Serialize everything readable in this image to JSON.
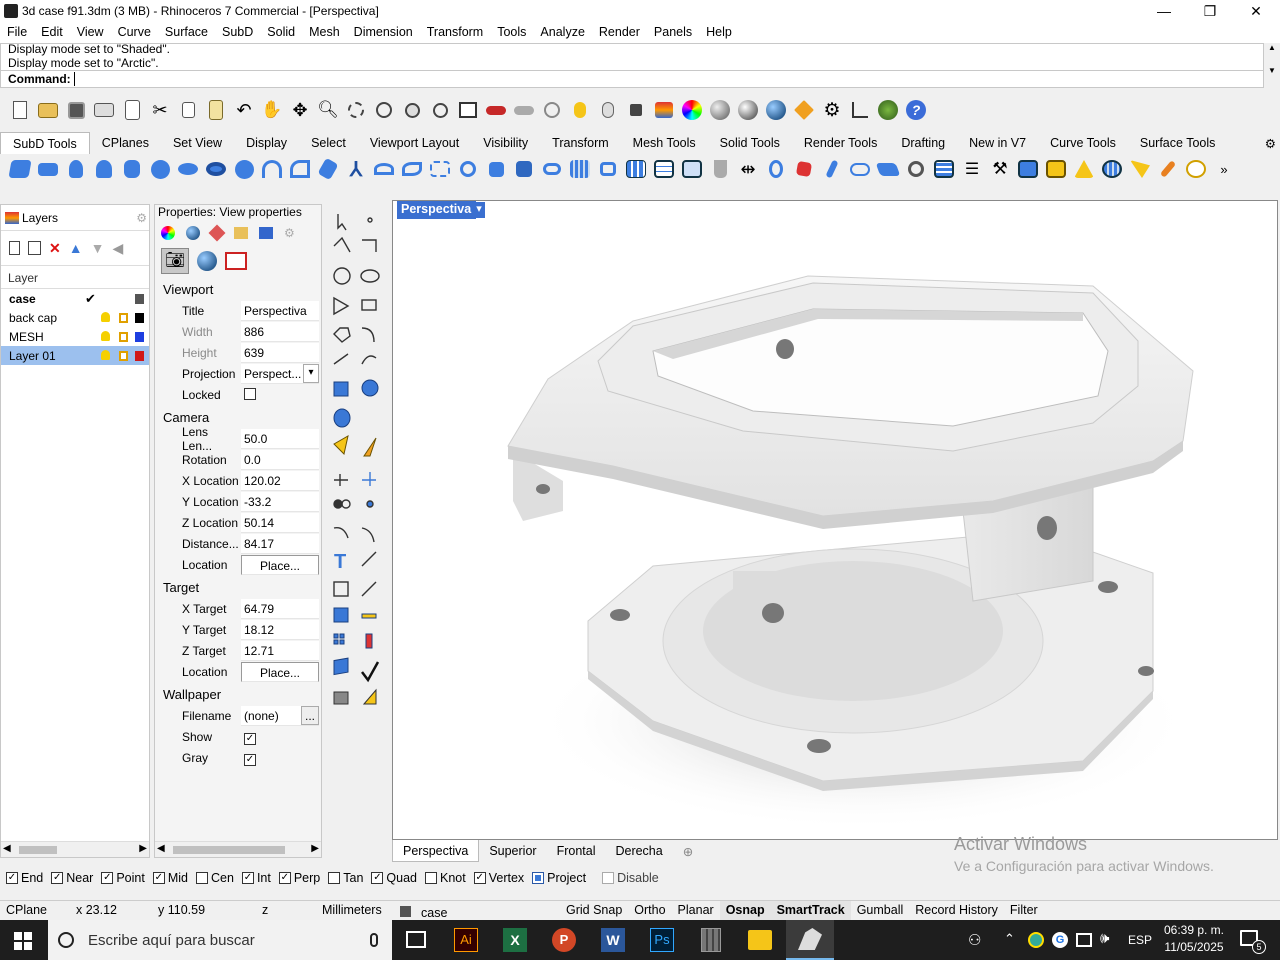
{
  "window": {
    "title": "3d case f91.3dm (3 MB) - Rhinoceros 7 Commercial - [Perspectiva]",
    "minimize": "—",
    "restore": "❐",
    "close": "✕"
  },
  "menu": [
    "File",
    "Edit",
    "View",
    "Curve",
    "Surface",
    "SubD",
    "Solid",
    "Mesh",
    "Dimension",
    "Transform",
    "Tools",
    "Analyze",
    "Render",
    "Panels",
    "Help"
  ],
  "command": {
    "history": [
      "Display mode set to \"Shaded\".",
      "Display mode set to \"Arctic\"."
    ],
    "prompt": "Command:"
  },
  "toolbar_tabs": [
    "SubD Tools",
    "CPlanes",
    "Set View",
    "Display",
    "Select",
    "Viewport Layout",
    "Visibility",
    "Transform",
    "Mesh Tools",
    "Solid Tools",
    "Render Tools",
    "Drafting",
    "New in V7",
    "Curve Tools",
    "Surface Tools"
  ],
  "colors": {
    "accent": "#3a78d6",
    "selection": "#9cc0ee",
    "viewport_tab": "#3a6fd0",
    "taskbar": "#1e1e1e"
  },
  "layers_panel": {
    "title": "Layers",
    "column_header": "Layer",
    "rows": [
      {
        "name": "case",
        "current": "✔",
        "color": "#555555"
      },
      {
        "name": "back cap",
        "color": "#000000"
      },
      {
        "name": "MESH",
        "color": "#1d3ee0"
      },
      {
        "name": "Layer 01",
        "color": "#d01818"
      }
    ]
  },
  "properties_panel": {
    "title": "Properties: View properties",
    "sections": {
      "viewport": "Viewport",
      "camera": "Camera",
      "target": "Target",
      "wallpaper": "Wallpaper"
    },
    "viewport": {
      "title": {
        "label": "Title",
        "value": "Perspectiva"
      },
      "width": {
        "label": "Width",
        "value": "886"
      },
      "height": {
        "label": "Height",
        "value": "639"
      },
      "projection": {
        "label": "Projection",
        "value": "Perspect..."
      },
      "locked": {
        "label": "Locked"
      }
    },
    "camera": {
      "lens": {
        "label": "Lens Len...",
        "value": "50.0"
      },
      "rotation": {
        "label": "Rotation",
        "value": "0.0"
      },
      "x": {
        "label": "X Location",
        "value": "120.02"
      },
      "y": {
        "label": "Y Location",
        "value": "-33.2"
      },
      "z": {
        "label": "Z Location",
        "value": "50.14"
      },
      "distance": {
        "label": "Distance...",
        "value": "84.17"
      },
      "location": {
        "label": "Location",
        "value": "Place..."
      }
    },
    "target": {
      "x": {
        "label": "X Target",
        "value": "64.79"
      },
      "y": {
        "label": "Y Target",
        "value": "18.12"
      },
      "z": {
        "label": "Z Target",
        "value": "12.71"
      },
      "location": {
        "label": "Location",
        "value": "Place..."
      }
    },
    "wallpaper": {
      "filename": {
        "label": "Filename",
        "value": "(none)",
        "browse": "..."
      },
      "show": {
        "label": "Show",
        "checked": "✓"
      },
      "gray": {
        "label": "Gray",
        "checked": "✓"
      }
    }
  },
  "viewport": {
    "title": "Perspectiva",
    "dropdown": "▾",
    "tabs": [
      "Perspectiva",
      "Superior",
      "Frontal",
      "Derecha"
    ],
    "add_tab": "⊕",
    "watermark_title": "Activar Windows",
    "watermark_sub": "Ve a Configuración para activar Windows."
  },
  "osnap": [
    {
      "label": "End",
      "checked": true
    },
    {
      "label": "Near",
      "checked": true
    },
    {
      "label": "Point",
      "checked": true
    },
    {
      "label": "Mid",
      "checked": true
    },
    {
      "label": "Cen",
      "checked": false
    },
    {
      "label": "Int",
      "checked": true
    },
    {
      "label": "Perp",
      "checked": true
    },
    {
      "label": "Tan",
      "checked": false
    },
    {
      "label": "Quad",
      "checked": true
    },
    {
      "label": "Knot",
      "checked": false
    },
    {
      "label": "Vertex",
      "checked": true
    },
    {
      "label": "Project",
      "checked": true
    },
    {
      "label": "Disable",
      "checked": false
    }
  ],
  "status": {
    "cplane": "CPlane",
    "x": "x 23.12",
    "y": "y 110.59",
    "z": "z",
    "units": "Millimeters",
    "layer": "case",
    "toggles": [
      "Grid Snap",
      "Ortho",
      "Planar",
      "Osnap",
      "SmartTrack",
      "Gumball",
      "Record History",
      "Filter"
    ]
  },
  "taskbar": {
    "search_placeholder": "Escribe aquí para buscar",
    "language": "ESP",
    "time": "06:39 p. m.",
    "date": "11/05/2025",
    "notifications": "5",
    "apps": [
      "Ai",
      "X",
      "P",
      "W",
      "Ps"
    ]
  }
}
